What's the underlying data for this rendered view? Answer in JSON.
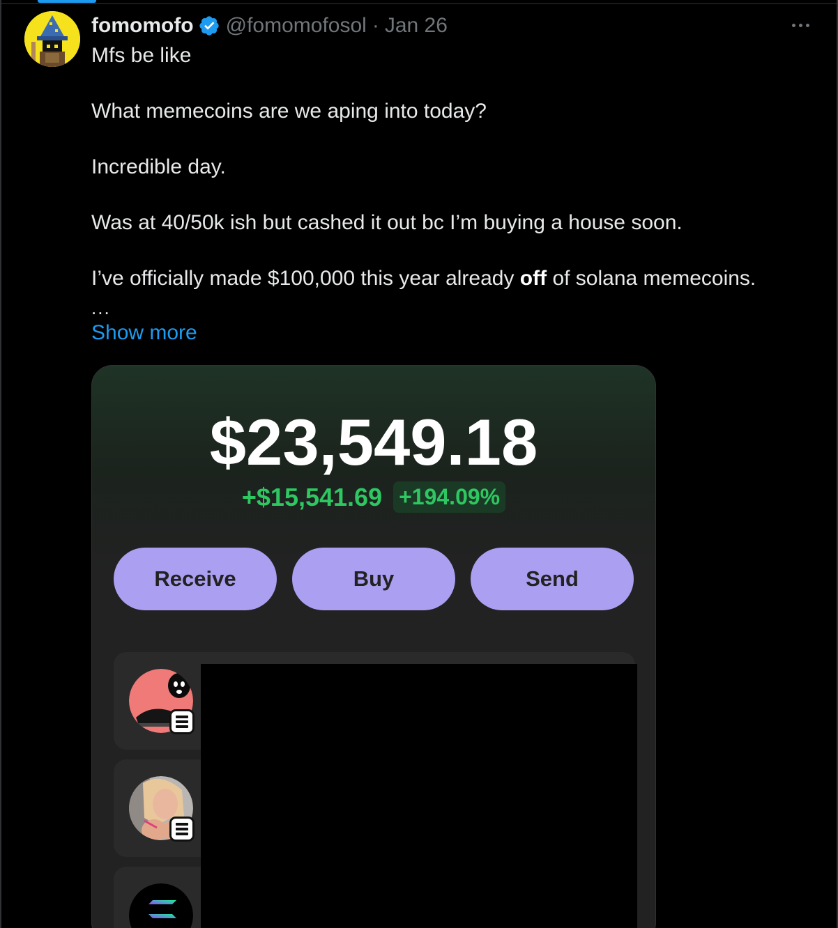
{
  "tweet": {
    "author": {
      "display_name": "fomomofo",
      "handle": "@fomomofosol",
      "verified": true,
      "avatar_icon": "pixel-wizard-avatar"
    },
    "separator": "·",
    "date": "Jan 26",
    "text": {
      "line1": "Mfs be like",
      "line2": "What memecoins are we aping into today?",
      "line3": "Incredible day.",
      "line4": "Was at 40/50k ish but cashed it out bc I’m buying a house soon.",
      "line5_before": "I’ve officially made $100,000 this year already ",
      "line5_bold": "off",
      "line5_after": " of solana memecoins.",
      "ellipsis": "..."
    },
    "show_more_label": "Show more",
    "colors": {
      "link": "#1d9bf0",
      "verified": "#1d9bf0",
      "muted": "#71767b"
    }
  },
  "media": {
    "balance": "$23,549.18",
    "change_usd": "+$15,541.69",
    "change_pct": "+194.09%",
    "buttons": {
      "receive": "Receive",
      "buy": "Buy",
      "send": "Send"
    },
    "tokens": [
      {
        "icon": "masked-figure-shoe-icon",
        "chain_badge": "solana-badge-icon"
      },
      {
        "icon": "photo-avatar-icon",
        "chain_badge": "solana-badge-icon"
      },
      {
        "icon": "solana-logo-icon"
      }
    ],
    "colors": {
      "accent_button": "#ab9ff2",
      "positive": "#2ec762"
    }
  }
}
